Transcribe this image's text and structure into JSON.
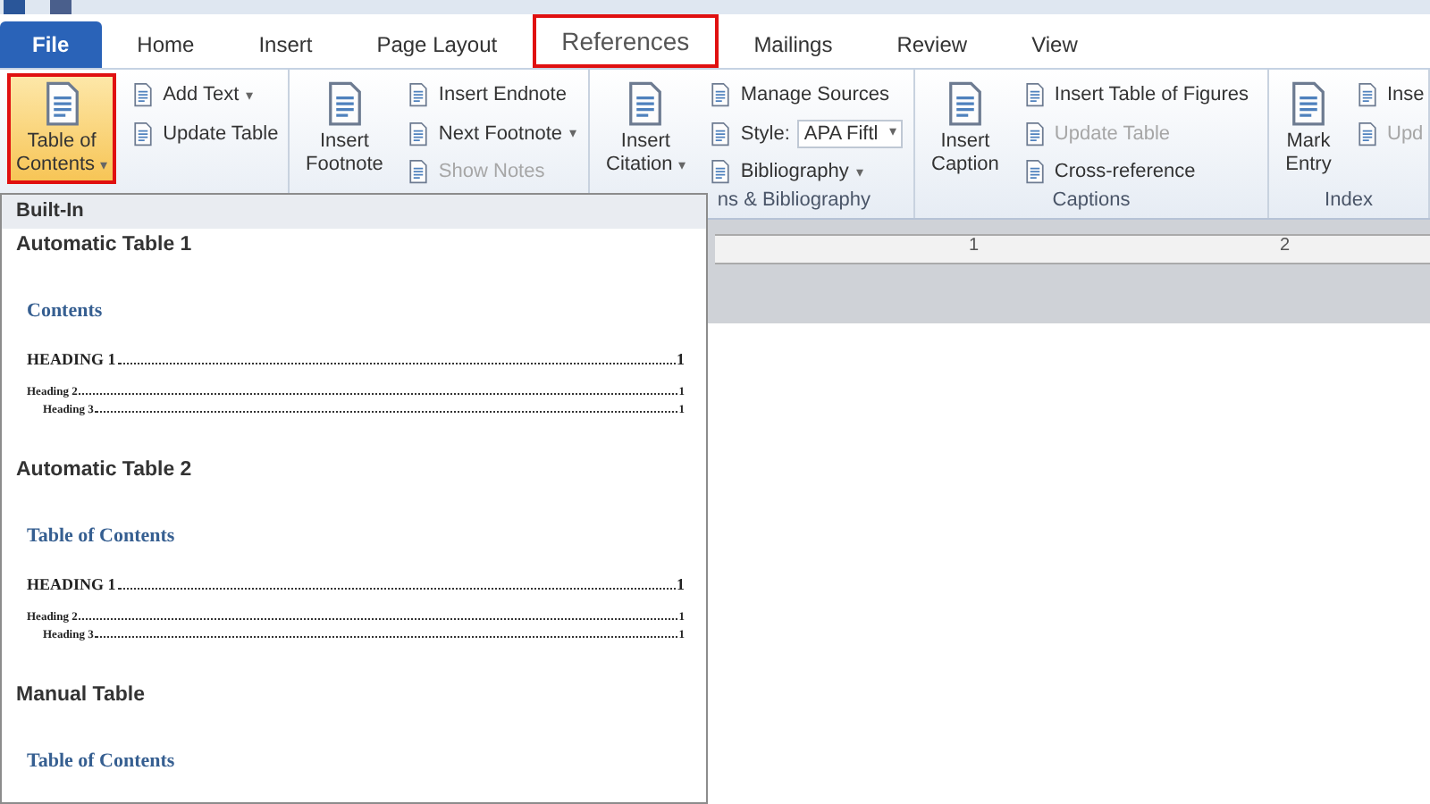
{
  "tabs": [
    {
      "label": "File",
      "kind": "file",
      "selected": false,
      "highlighted": false
    },
    {
      "label": "Home",
      "kind": "tab",
      "selected": false,
      "highlighted": false
    },
    {
      "label": "Insert",
      "kind": "tab",
      "selected": false,
      "highlighted": false
    },
    {
      "label": "Page Layout",
      "kind": "tab",
      "selected": false,
      "highlighted": false
    },
    {
      "label": "References",
      "kind": "tab",
      "selected": true,
      "highlighted": true
    },
    {
      "label": "Mailings",
      "kind": "tab",
      "selected": false,
      "highlighted": false
    },
    {
      "label": "Review",
      "kind": "tab",
      "selected": false,
      "highlighted": false
    },
    {
      "label": "View",
      "kind": "tab",
      "selected": false,
      "highlighted": false
    }
  ],
  "ribbon": {
    "groups": [
      {
        "large": {
          "lines": [
            "Table of",
            "Contents"
          ],
          "caret": "▾",
          "pressed": true,
          "highlighted": true
        },
        "items": [
          {
            "label": "Add Text",
            "caret": "▾",
            "disabled": false
          },
          {
            "label": "Update Table",
            "disabled": false
          }
        ]
      },
      {
        "large": {
          "lines": [
            "Insert",
            "Footnote"
          ],
          "pressed": false,
          "highlighted": false
        },
        "items": [
          {
            "label": "Insert Endnote",
            "disabled": false
          },
          {
            "label": "Next Footnote",
            "caret": "▾",
            "disabled": false
          },
          {
            "label": "Show Notes",
            "disabled": true
          }
        ]
      },
      {
        "label": "ns & Bibliography",
        "large": {
          "lines": [
            "Insert",
            "Citation"
          ],
          "caret": "▾",
          "pressed": false,
          "highlighted": false
        },
        "items": [
          {
            "label": "Manage Sources",
            "disabled": false
          },
          {
            "label": "Style:",
            "kind": "combo",
            "value": "APA Fiftl",
            "caret": "▾",
            "disabled": false
          },
          {
            "label": "Bibliography",
            "caret": "▾",
            "disabled": false
          }
        ]
      },
      {
        "label": "Captions",
        "large": {
          "lines": [
            "Insert",
            "Caption"
          ],
          "pressed": false,
          "highlighted": false
        },
        "items": [
          {
            "label": "Insert Table of Figures",
            "disabled": false
          },
          {
            "label": "Update Table",
            "disabled": true
          },
          {
            "label": "Cross-reference",
            "disabled": false
          }
        ]
      },
      {
        "label": "Index",
        "large": {
          "lines": [
            "Mark",
            "Entry"
          ],
          "pressed": false,
          "highlighted": false
        },
        "items": [
          {
            "label": "Inse",
            "disabled": false
          },
          {
            "label": "Upd",
            "disabled": true
          }
        ]
      }
    ]
  },
  "ruler": {
    "labels": [
      "1",
      "2"
    ]
  },
  "toc_menu": {
    "header": "Built-In",
    "sections": [
      {
        "title": "Automatic Table 1",
        "preview": {
          "heading": "Contents",
          "entries": [
            {
              "text": "HEADING 1",
              "page": "1",
              "children": [
                {
                  "text": "Heading 2",
                  "page": "1",
                  "children": [
                    {
                      "text": "Heading 3",
                      "page": "1"
                    }
                  ]
                }
              ]
            }
          ]
        }
      },
      {
        "title": "Automatic Table 2",
        "preview": {
          "heading": "Table of Contents",
          "entries": [
            {
              "text": "HEADING 1",
              "page": "1",
              "children": [
                {
                  "text": "Heading 2",
                  "page": "1",
                  "children": [
                    {
                      "text": "Heading 3",
                      "page": "1"
                    }
                  ]
                }
              ]
            }
          ]
        }
      },
      {
        "title": "Manual Table",
        "preview": {
          "heading": "Table of Contents"
        }
      }
    ]
  }
}
